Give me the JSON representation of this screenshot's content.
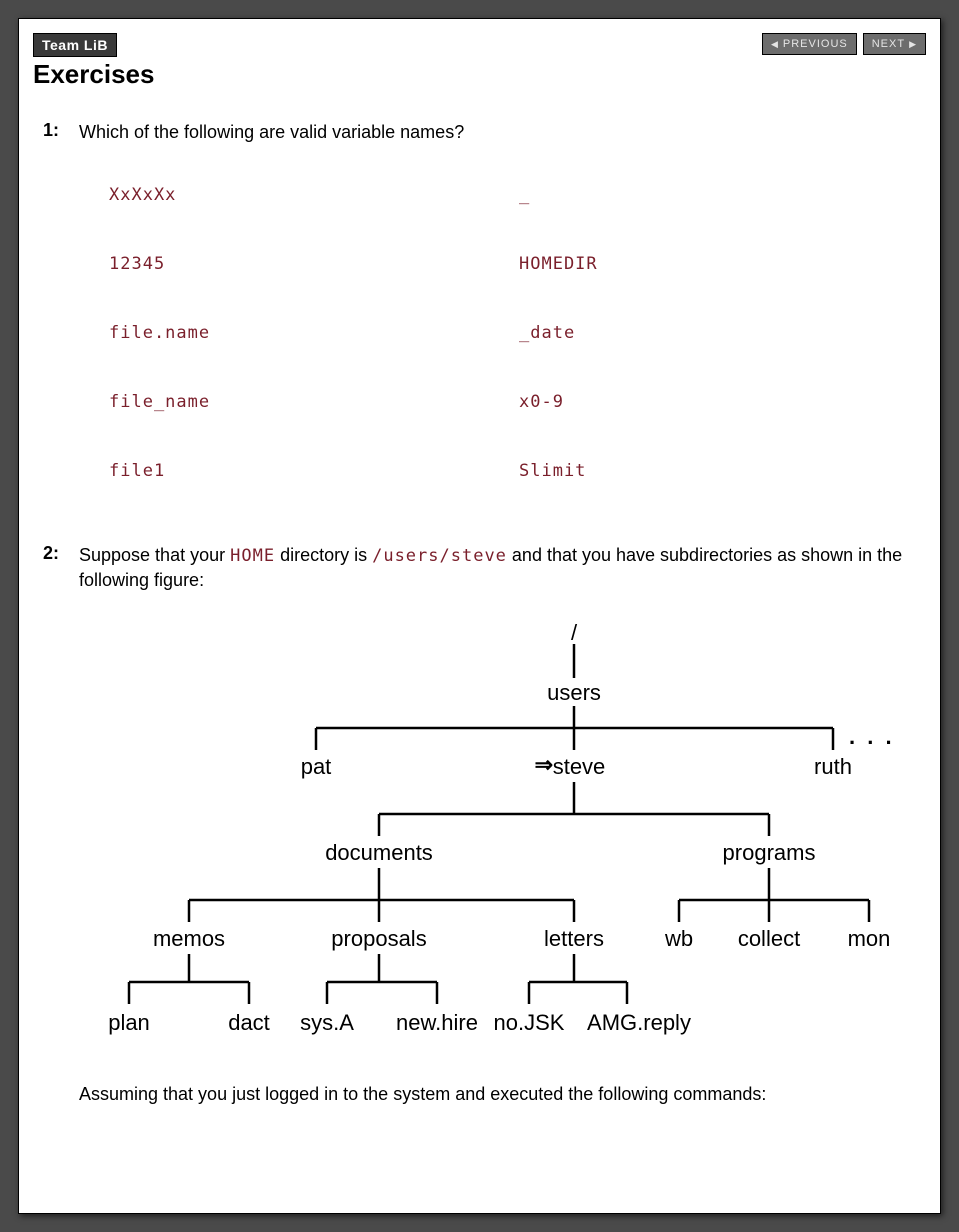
{
  "nav": {
    "team_lib": "Team LiB",
    "previous": "PREVIOUS",
    "next": "NEXT"
  },
  "title": "Exercises",
  "ex1": {
    "num": "1:",
    "question": "Which of the following are valid variable names?",
    "items": {
      "r1c1": "XxXxXx",
      "r1c2": "_",
      "r2c1": "12345",
      "r2c2": "HOMEDIR",
      "r3c1": "file.name",
      "r3c2": "_date",
      "r4c1": "file_name",
      "r4c2": "x0-9",
      "r5c1": "file1",
      "r5c2": "Slimit"
    }
  },
  "ex2": {
    "num": "2:",
    "p1a": "Suppose that your ",
    "p1_home": "HOME",
    "p1b": " directory is ",
    "p1_path": "/users/steve",
    "p1c": " and that you have subdirectories as shown in the following figure:",
    "tree": {
      "root": "/",
      "users": "users",
      "pat": "pat",
      "steve": "steve",
      "ruth": "ruth",
      "dots": ". . .",
      "documents": "documents",
      "programs": "programs",
      "memos": "memos",
      "proposals": "proposals",
      "letters": "letters",
      "wb": "wb",
      "collect": "collect",
      "mon": "mon",
      "plan": "plan",
      "dact": "dact",
      "sysA": "sys.A",
      "newhire": "new.hire",
      "noJSK": "no.JSK",
      "amgreply": "AMG.reply"
    },
    "after": "Assuming that you just logged in to the system and executed the following commands:"
  }
}
